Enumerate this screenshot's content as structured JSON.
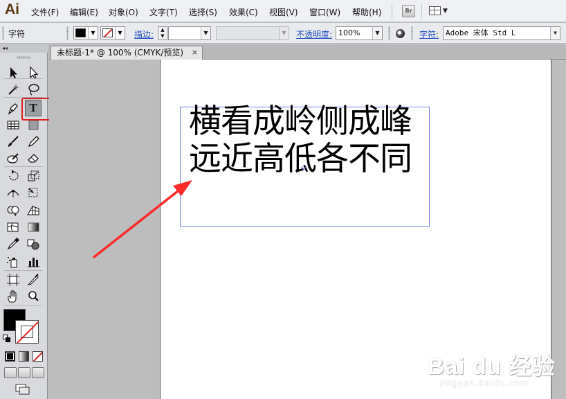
{
  "app": {
    "logo": "Ai"
  },
  "menu": {
    "items": [
      "文件(F)",
      "编辑(E)",
      "对象(O)",
      "文字(T)",
      "选择(S)",
      "效果(C)",
      "视图(V)",
      "窗口(W)",
      "帮助(H)"
    ],
    "bridge_button": "Br"
  },
  "control_bar": {
    "panel_label": "字符",
    "fill_color": "#000000",
    "stroke_color": "none",
    "stroke_label": "描边:",
    "stroke_value": "",
    "style_value": "",
    "opacity_label": "不透明度:",
    "opacity_value": "100%",
    "font_label": "字符:",
    "font_value": "Adobe 宋体 Std L"
  },
  "toolbox": {
    "collapse_glyph": "◂◂",
    "active_tool": "type-tool",
    "type_tool_glyph": "T",
    "fill_color": "#000000",
    "stroke_color": "none"
  },
  "document": {
    "tab_title": "未标题-1* @ 100% (CMYK/预览)",
    "tab_close": "×"
  },
  "text_frame": {
    "lines": [
      "横看成岭侧成峰",
      "远近高低各不同"
    ]
  },
  "annotation": {
    "arrow_color": "#ff2a2a",
    "highlight_color": "#e02020"
  },
  "watermark": {
    "brand": "Bai du 经验",
    "url": "jingyan.baidu.com"
  }
}
